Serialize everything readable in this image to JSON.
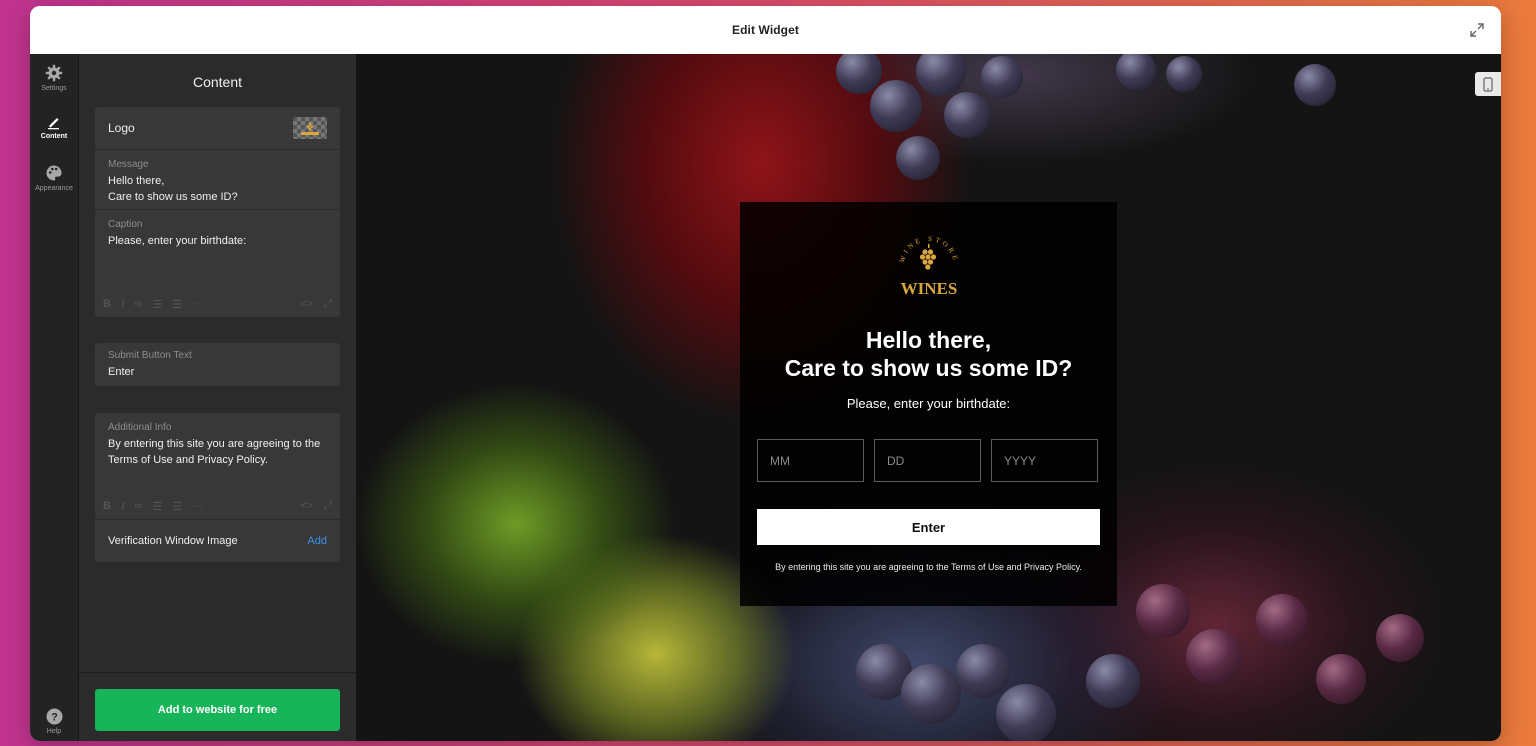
{
  "window": {
    "title": "Edit Widget"
  },
  "rail": {
    "items": [
      {
        "label": "Settings",
        "icon": "gear-icon"
      },
      {
        "label": "Content",
        "icon": "pencil-icon"
      },
      {
        "label": "Appearance",
        "icon": "palette-icon"
      }
    ],
    "help": "Help"
  },
  "panel": {
    "title": "Content",
    "logo_label": "Logo",
    "message": {
      "label": "Message",
      "value": "Hello there,\nCare to show us some ID?"
    },
    "caption": {
      "label": "Caption",
      "value": "Please, enter your birthdate:"
    },
    "submit": {
      "label": "Submit Button Text",
      "value": "Enter"
    },
    "additional": {
      "label": "Additional Info",
      "value": "By entering this site you are agreeing to the Terms of Use and Privacy Policy."
    },
    "verification_image": {
      "label": "Verification Window Image",
      "action": "Add"
    },
    "cta": "Add to website for free"
  },
  "preview": {
    "logo_text": "WINES",
    "logo_arc": "WINE STORE",
    "message": "Hello there,\nCare to show us some ID?",
    "caption": "Please, enter your birthdate:",
    "placeholders": {
      "mm": "MM",
      "dd": "DD",
      "yyyy": "YYYY"
    },
    "button": "Enter",
    "info": "By entering this site you are agreeing to the Terms of Use and Privacy Policy."
  },
  "colors": {
    "accent_green": "#17b45a",
    "link_blue": "#3b8fe9",
    "logo_gold": "#d9a640"
  }
}
